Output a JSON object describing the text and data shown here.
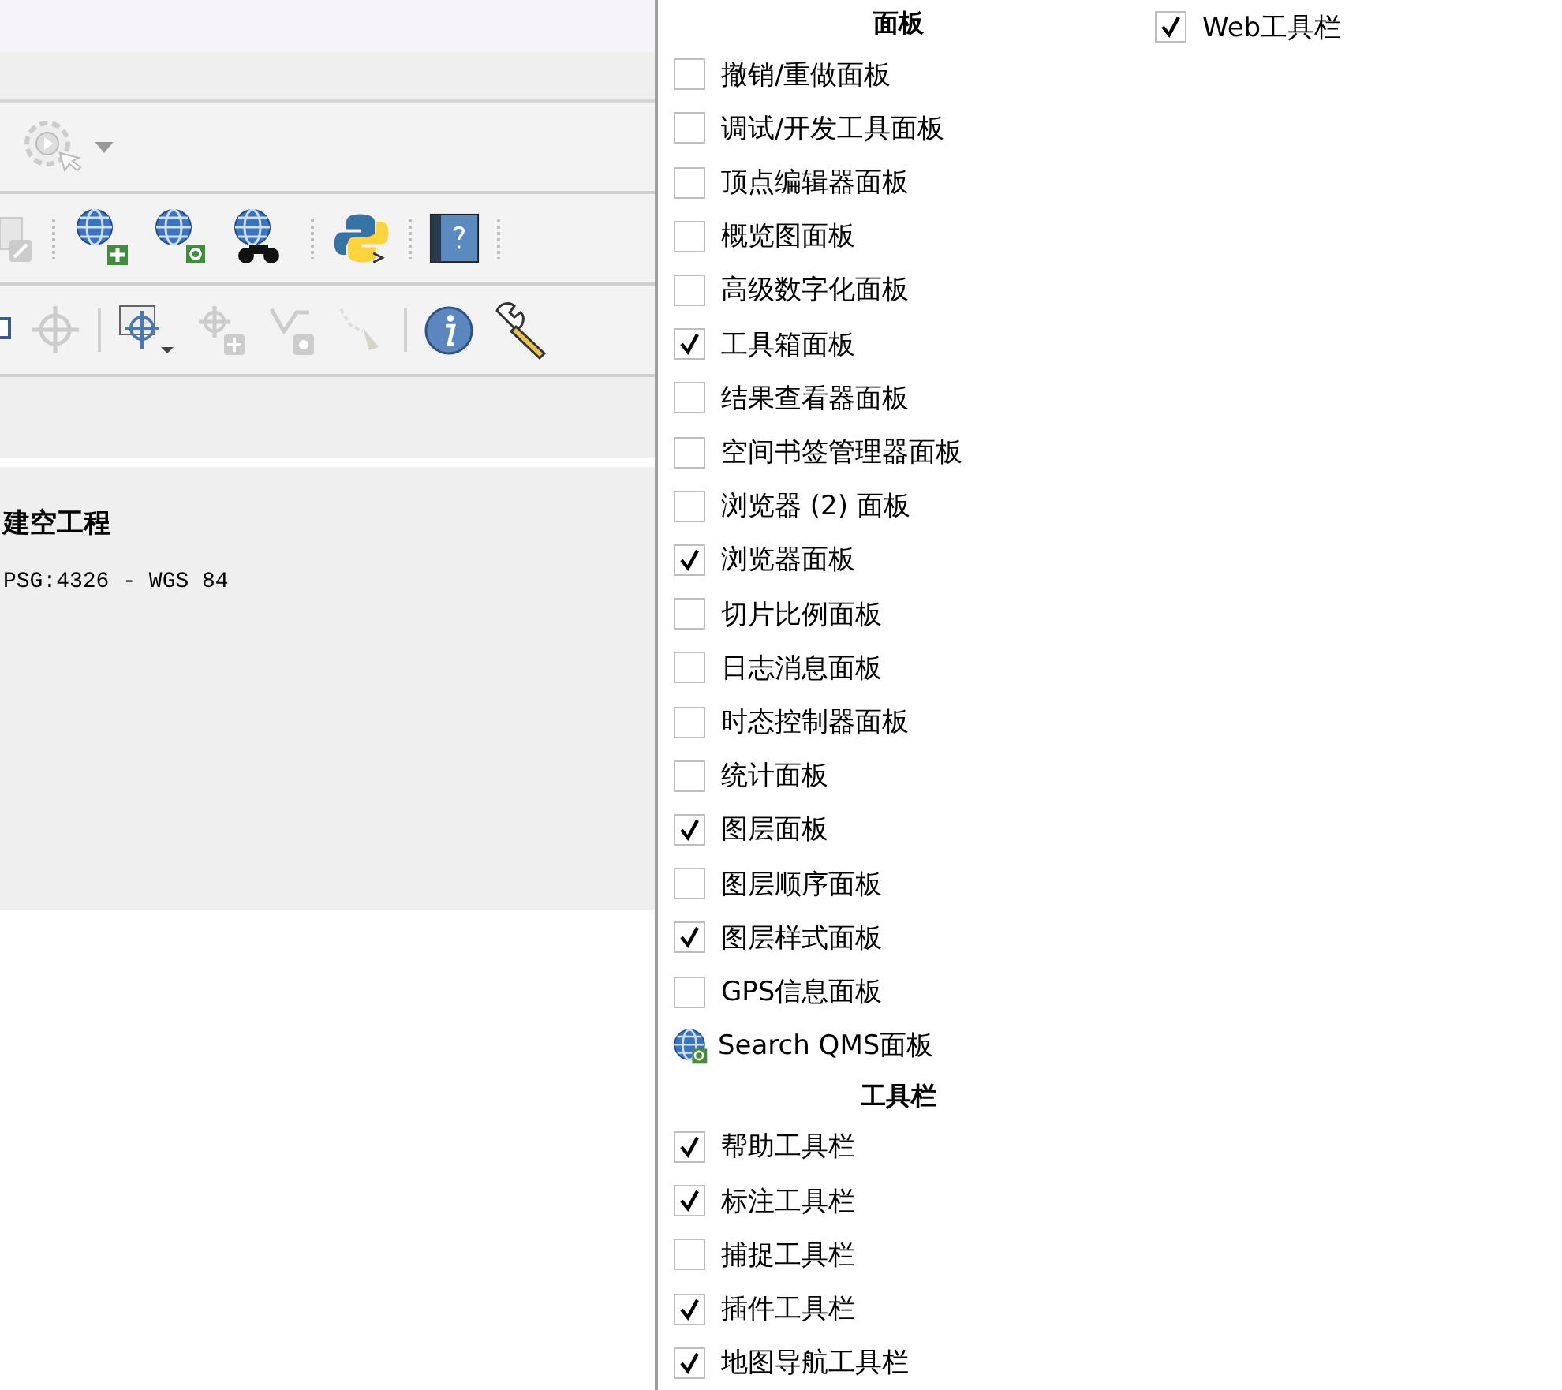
{
  "project": {
    "title": "建空工程",
    "crs": "PSG:4326 - WGS 84"
  },
  "menu": {
    "sections": [
      {
        "title": "面板",
        "items": [
          {
            "kind": "checkbox",
            "label": "撤销/重做面板",
            "checked": false
          },
          {
            "kind": "checkbox",
            "label": "调试/开发工具面板",
            "checked": false
          },
          {
            "kind": "checkbox",
            "label": "顶点编辑器面板",
            "checked": false
          },
          {
            "kind": "checkbox",
            "label": "概览图面板",
            "checked": false
          },
          {
            "kind": "checkbox",
            "label": "高级数字化面板",
            "checked": false
          },
          {
            "kind": "checkbox",
            "label": "工具箱面板",
            "checked": true
          },
          {
            "kind": "checkbox",
            "label": "结果查看器面板",
            "checked": false
          },
          {
            "kind": "checkbox",
            "label": "空间书签管理器面板",
            "checked": false
          },
          {
            "kind": "checkbox",
            "label": "浏览器 (2) 面板",
            "checked": false
          },
          {
            "kind": "checkbox",
            "label": "浏览器面板",
            "checked": true
          },
          {
            "kind": "checkbox",
            "label": "切片比例面板",
            "checked": false
          },
          {
            "kind": "checkbox",
            "label": "日志消息面板",
            "checked": false
          },
          {
            "kind": "checkbox",
            "label": "时态控制器面板",
            "checked": false
          },
          {
            "kind": "checkbox",
            "label": "统计面板",
            "checked": false
          },
          {
            "kind": "checkbox",
            "label": "图层面板",
            "checked": true
          },
          {
            "kind": "checkbox",
            "label": "图层顺序面板",
            "checked": false
          },
          {
            "kind": "checkbox",
            "label": "图层样式面板",
            "checked": true
          },
          {
            "kind": "checkbox",
            "label": "GPS信息面板",
            "checked": false
          },
          {
            "kind": "icon",
            "label": "Search QMS面板"
          }
        ]
      },
      {
        "title": "工具栏",
        "items": [
          {
            "kind": "checkbox",
            "label": "帮助工具栏",
            "checked": true
          },
          {
            "kind": "checkbox",
            "label": "标注工具栏",
            "checked": true
          },
          {
            "kind": "checkbox",
            "label": "捕捉工具栏",
            "checked": false
          },
          {
            "kind": "checkbox",
            "label": "插件工具栏",
            "checked": true
          },
          {
            "kind": "checkbox",
            "label": "地图导航工具栏",
            "checked": true
          }
        ]
      }
    ],
    "column_2": [
      {
        "kind": "checkbox",
        "label": "Web工具栏",
        "checked": true
      }
    ]
  }
}
